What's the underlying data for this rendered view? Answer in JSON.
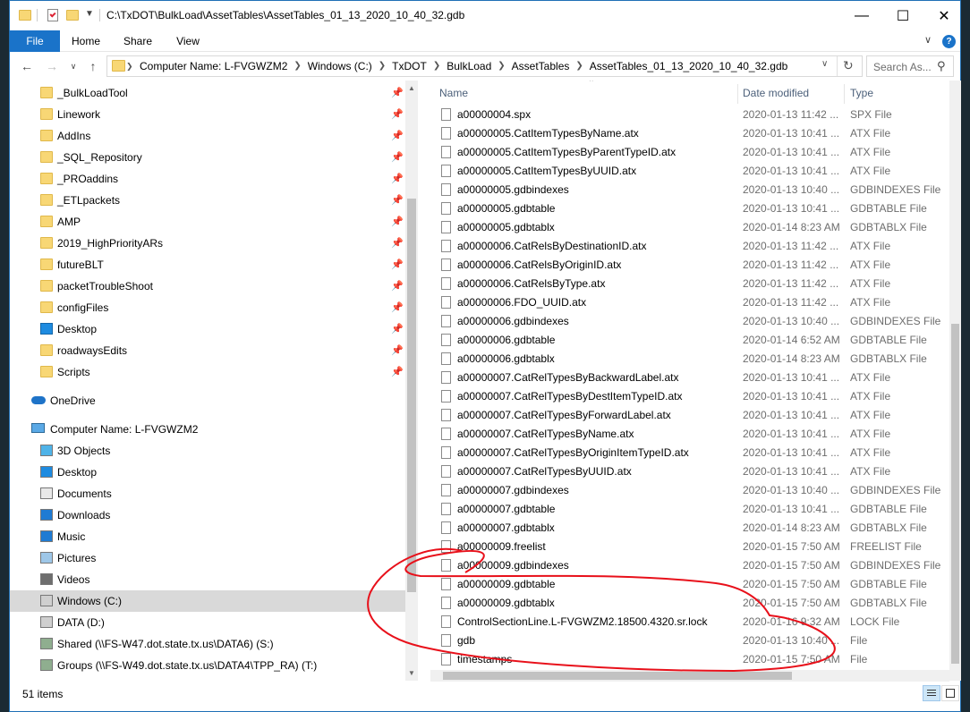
{
  "window": {
    "title": "C:\\TxDOT\\BulkLoad\\AssetTables\\AssetTables_01_13_2020_10_40_32.gdb",
    "minimize": "—",
    "maximize": "☐",
    "close": "✕"
  },
  "ribbon": {
    "tabs": [
      "File",
      "Home",
      "Share",
      "View"
    ],
    "expand": "∨",
    "help": "?"
  },
  "address": {
    "crumbs": [
      "Computer Name:  L-FVGWZM2",
      "Windows (C:)",
      "TxDOT",
      "BulkLoad",
      "AssetTables",
      "AssetTables_01_13_2020_10_40_32.gdb"
    ],
    "search_placeholder": "Search As..."
  },
  "navpane": {
    "quick_access": [
      {
        "label": "_BulkLoadTool",
        "pinned": true
      },
      {
        "label": "Linework",
        "pinned": true
      },
      {
        "label": "AddIns",
        "pinned": true
      },
      {
        "label": "_SQL_Repository",
        "pinned": true
      },
      {
        "label": "_PROaddins",
        "pinned": true
      },
      {
        "label": "_ETLpackets",
        "pinned": true
      },
      {
        "label": "AMP",
        "pinned": true
      },
      {
        "label": "2019_HighPriorityARs",
        "pinned": true
      },
      {
        "label": "futureBLT",
        "pinned": true
      },
      {
        "label": "packetTroubleShoot",
        "pinned": true
      },
      {
        "label": "configFiles",
        "pinned": true
      },
      {
        "label": "Desktop",
        "pinned": true
      },
      {
        "label": "roadwaysEdits",
        "pinned": true
      },
      {
        "label": "Scripts",
        "pinned": true
      }
    ],
    "onedrive": "OneDrive",
    "computer": "Computer Name:  L-FVGWZM2",
    "computer_items": [
      {
        "label": "3D Objects",
        "icon": "3d-objects-icon"
      },
      {
        "label": "Desktop",
        "icon": "desktop-icon"
      },
      {
        "label": "Documents",
        "icon": "documents-icon"
      },
      {
        "label": "Downloads",
        "icon": "downloads-icon"
      },
      {
        "label": "Music",
        "icon": "music-icon"
      },
      {
        "label": "Pictures",
        "icon": "pictures-icon"
      },
      {
        "label": "Videos",
        "icon": "videos-icon"
      },
      {
        "label": "Windows (C:)",
        "icon": "drive-icon"
      },
      {
        "label": "DATA (D:)",
        "icon": "drive-icon"
      },
      {
        "label": "Shared (\\\\FS-W47.dot.state.tx.us\\DATA6) (S:)",
        "icon": "network-drive-icon"
      },
      {
        "label": "Groups (\\\\FS-W49.dot.state.tx.us\\DATA4\\TPP_RA) (T:)",
        "icon": "network-drive-icon"
      }
    ],
    "selected": "Windows (C:)"
  },
  "columns": {
    "name": "Name",
    "date": "Date modified",
    "type": "Type"
  },
  "files": [
    {
      "name": "a00000004.spx",
      "date": "2020-01-13 11:42 ...",
      "type": "SPX File"
    },
    {
      "name": "a00000005.CatItemTypesByName.atx",
      "date": "2020-01-13 10:41 ...",
      "type": "ATX File"
    },
    {
      "name": "a00000005.CatItemTypesByParentTypeID.atx",
      "date": "2020-01-13 10:41 ...",
      "type": "ATX File"
    },
    {
      "name": "a00000005.CatItemTypesByUUID.atx",
      "date": "2020-01-13 10:41 ...",
      "type": "ATX File"
    },
    {
      "name": "a00000005.gdbindexes",
      "date": "2020-01-13 10:40 ...",
      "type": "GDBINDEXES File"
    },
    {
      "name": "a00000005.gdbtable",
      "date": "2020-01-13 10:41 ...",
      "type": "GDBTABLE File"
    },
    {
      "name": "a00000005.gdbtablx",
      "date": "2020-01-14 8:23 AM",
      "type": "GDBTABLX File"
    },
    {
      "name": "a00000006.CatRelsByDestinationID.atx",
      "date": "2020-01-13 11:42 ...",
      "type": "ATX File"
    },
    {
      "name": "a00000006.CatRelsByOriginID.atx",
      "date": "2020-01-13 11:42 ...",
      "type": "ATX File"
    },
    {
      "name": "a00000006.CatRelsByType.atx",
      "date": "2020-01-13 11:42 ...",
      "type": "ATX File"
    },
    {
      "name": "a00000006.FDO_UUID.atx",
      "date": "2020-01-13 11:42 ...",
      "type": "ATX File"
    },
    {
      "name": "a00000006.gdbindexes",
      "date": "2020-01-13 10:40 ...",
      "type": "GDBINDEXES File"
    },
    {
      "name": "a00000006.gdbtable",
      "date": "2020-01-14 6:52 AM",
      "type": "GDBTABLE File"
    },
    {
      "name": "a00000006.gdbtablx",
      "date": "2020-01-14 8:23 AM",
      "type": "GDBTABLX File"
    },
    {
      "name": "a00000007.CatRelTypesByBackwardLabel.atx",
      "date": "2020-01-13 10:41 ...",
      "type": "ATX File"
    },
    {
      "name": "a00000007.CatRelTypesByDestItemTypeID.atx",
      "date": "2020-01-13 10:41 ...",
      "type": "ATX File"
    },
    {
      "name": "a00000007.CatRelTypesByForwardLabel.atx",
      "date": "2020-01-13 10:41 ...",
      "type": "ATX File"
    },
    {
      "name": "a00000007.CatRelTypesByName.atx",
      "date": "2020-01-13 10:41 ...",
      "type": "ATX File"
    },
    {
      "name": "a00000007.CatRelTypesByOriginItemTypeID.atx",
      "date": "2020-01-13 10:41 ...",
      "type": "ATX File"
    },
    {
      "name": "a00000007.CatRelTypesByUUID.atx",
      "date": "2020-01-13 10:41 ...",
      "type": "ATX File"
    },
    {
      "name": "a00000007.gdbindexes",
      "date": "2020-01-13 10:40 ...",
      "type": "GDBINDEXES File"
    },
    {
      "name": "a00000007.gdbtable",
      "date": "2020-01-13 10:41 ...",
      "type": "GDBTABLE File"
    },
    {
      "name": "a00000007.gdbtablx",
      "date": "2020-01-14 8:23 AM",
      "type": "GDBTABLX File"
    },
    {
      "name": "a00000009.freelist",
      "date": "2020-01-15 7:50 AM",
      "type": "FREELIST File"
    },
    {
      "name": "a00000009.gdbindexes",
      "date": "2020-01-15 7:50 AM",
      "type": "GDBINDEXES File"
    },
    {
      "name": "a00000009.gdbtable",
      "date": "2020-01-15 7:50 AM",
      "type": "GDBTABLE File"
    },
    {
      "name": "a00000009.gdbtablx",
      "date": "2020-01-15 7:50 AM",
      "type": "GDBTABLX File"
    },
    {
      "name": "ControlSectionLine.L-FVGWZM2.18500.4320.sr.lock",
      "date": "2020-01-16 9:32 AM",
      "type": "LOCK File"
    },
    {
      "name": "gdb",
      "date": "2020-01-13 10:40 ...",
      "type": "File"
    },
    {
      "name": "timestamps",
      "date": "2020-01-15 7:50 AM",
      "type": "File"
    }
  ],
  "status": {
    "count": "51 items"
  },
  "colors": {
    "accent": "#1a73c9",
    "annotation": "#e8101a",
    "selected": "#d9d9d9"
  }
}
